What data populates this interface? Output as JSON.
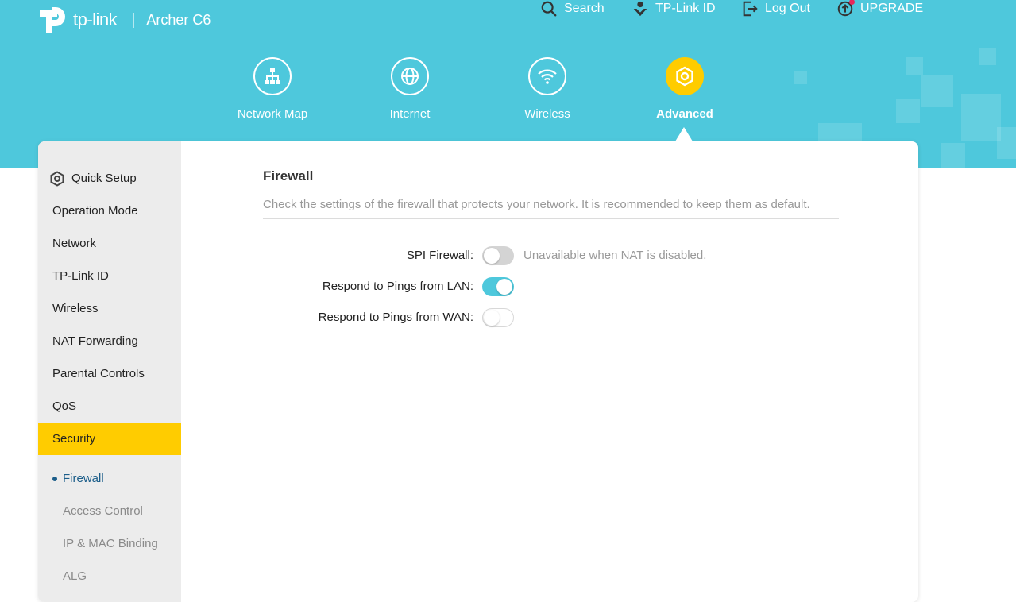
{
  "brand": {
    "logo_text": "tp-link",
    "separator": "|",
    "model": "Archer C6"
  },
  "top_actions": [
    {
      "label": "Search",
      "icon": "search-icon"
    },
    {
      "label": "TP-Link ID",
      "icon": "tplink-id-icon"
    },
    {
      "label": "Log Out",
      "icon": "logout-icon"
    },
    {
      "label": "UPGRADE",
      "icon": "upgrade-icon"
    }
  ],
  "nav": {
    "items": [
      {
        "label": "Network Map",
        "icon": "network-map-icon"
      },
      {
        "label": "Internet",
        "icon": "globe-icon"
      },
      {
        "label": "Wireless",
        "icon": "wifi-icon"
      },
      {
        "label": "Advanced",
        "icon": "gear-icon",
        "active": true
      }
    ]
  },
  "sidebar": {
    "items": [
      {
        "label": "Quick Setup",
        "icon": "gear-icon"
      },
      {
        "label": "Operation Mode"
      },
      {
        "label": "Network"
      },
      {
        "label": "TP-Link ID"
      },
      {
        "label": "Wireless"
      },
      {
        "label": "NAT Forwarding"
      },
      {
        "label": "Parental Controls"
      },
      {
        "label": "QoS"
      },
      {
        "label": "Security",
        "active": true
      }
    ],
    "sub_items": [
      {
        "label": "Firewall",
        "active": true
      },
      {
        "label": "Access Control"
      },
      {
        "label": "IP & MAC Binding"
      },
      {
        "label": "ALG"
      }
    ]
  },
  "main": {
    "title": "Firewall",
    "description": "Check the settings of the firewall that protects your network. It is recommended to keep them as default.",
    "settings": [
      {
        "label": "SPI Firewall:",
        "state": "off",
        "note": "Unavailable when NAT is disabled."
      },
      {
        "label": "Respond to Pings from LAN:",
        "state": "on"
      },
      {
        "label": "Respond to Pings from WAN:",
        "state": "off"
      }
    ]
  },
  "colors": {
    "banner": "#4ec8dc",
    "accent": "#ffcc00",
    "toggle_on": "#4ec8dc",
    "active_sub": "#1c5e8a"
  }
}
